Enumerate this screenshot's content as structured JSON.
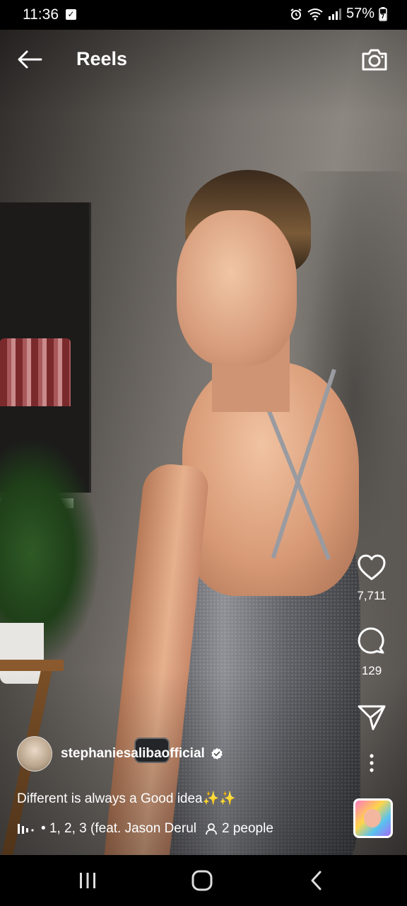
{
  "status_bar": {
    "time": "11:36",
    "battery": "57%"
  },
  "header": {
    "title": "Reels"
  },
  "actions": {
    "likes": "7,711",
    "comments": "129"
  },
  "post": {
    "username": "stephaniesalibaofficial",
    "caption": "Different is always a Good idea✨✨",
    "music": "1, 2, 3 (feat. Jason Derul",
    "people": "2 people"
  },
  "icons": {
    "back": "arrow-left-icon",
    "camera": "camera-icon",
    "like": "heart-icon",
    "comment": "comment-icon",
    "share": "send-icon",
    "more": "more-vertical-icon",
    "music": "music-bars-icon",
    "people": "person-icon",
    "verified": "verified-badge-icon"
  },
  "colors": {
    "overlay_text": "#ffffff",
    "status_bar_bg": "#000000",
    "nav_bar_bg": "#000000"
  }
}
